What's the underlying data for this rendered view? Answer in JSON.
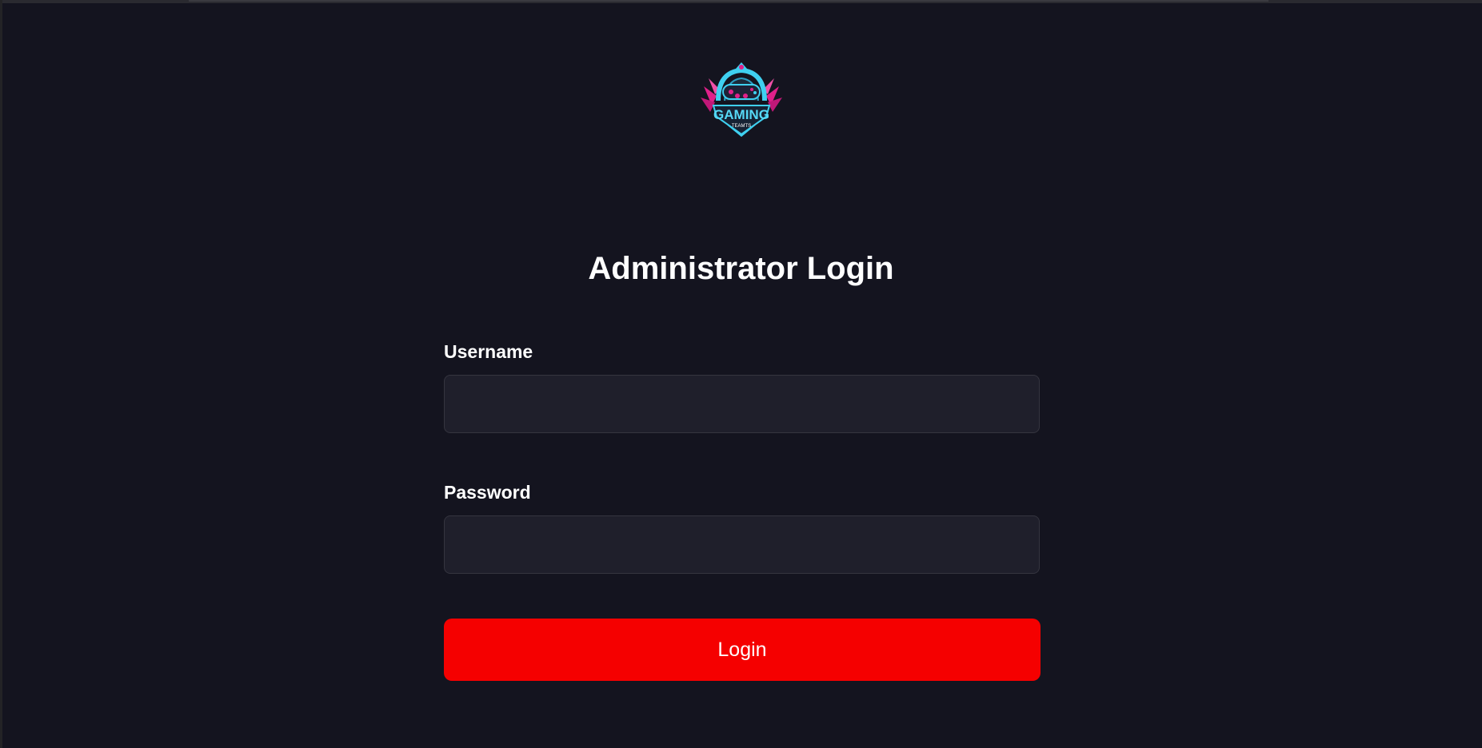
{
  "header": {
    "logo_icon": "gaming-teamts-logo",
    "logo_text": "GAMING",
    "logo_subtext": "TEAMTS"
  },
  "page": {
    "title": "Administrator Login"
  },
  "form": {
    "username_label": "Username",
    "username_value": "",
    "password_label": "Password",
    "password_value": "",
    "login_label": "Login"
  },
  "colors": {
    "background": "#14141f",
    "field_background": "#1f1f2b",
    "field_border": "#35353f",
    "button": "#f50000",
    "text": "#ffffff",
    "logo_cyan": "#3fd0f0",
    "logo_magenta": "#e0208a"
  }
}
